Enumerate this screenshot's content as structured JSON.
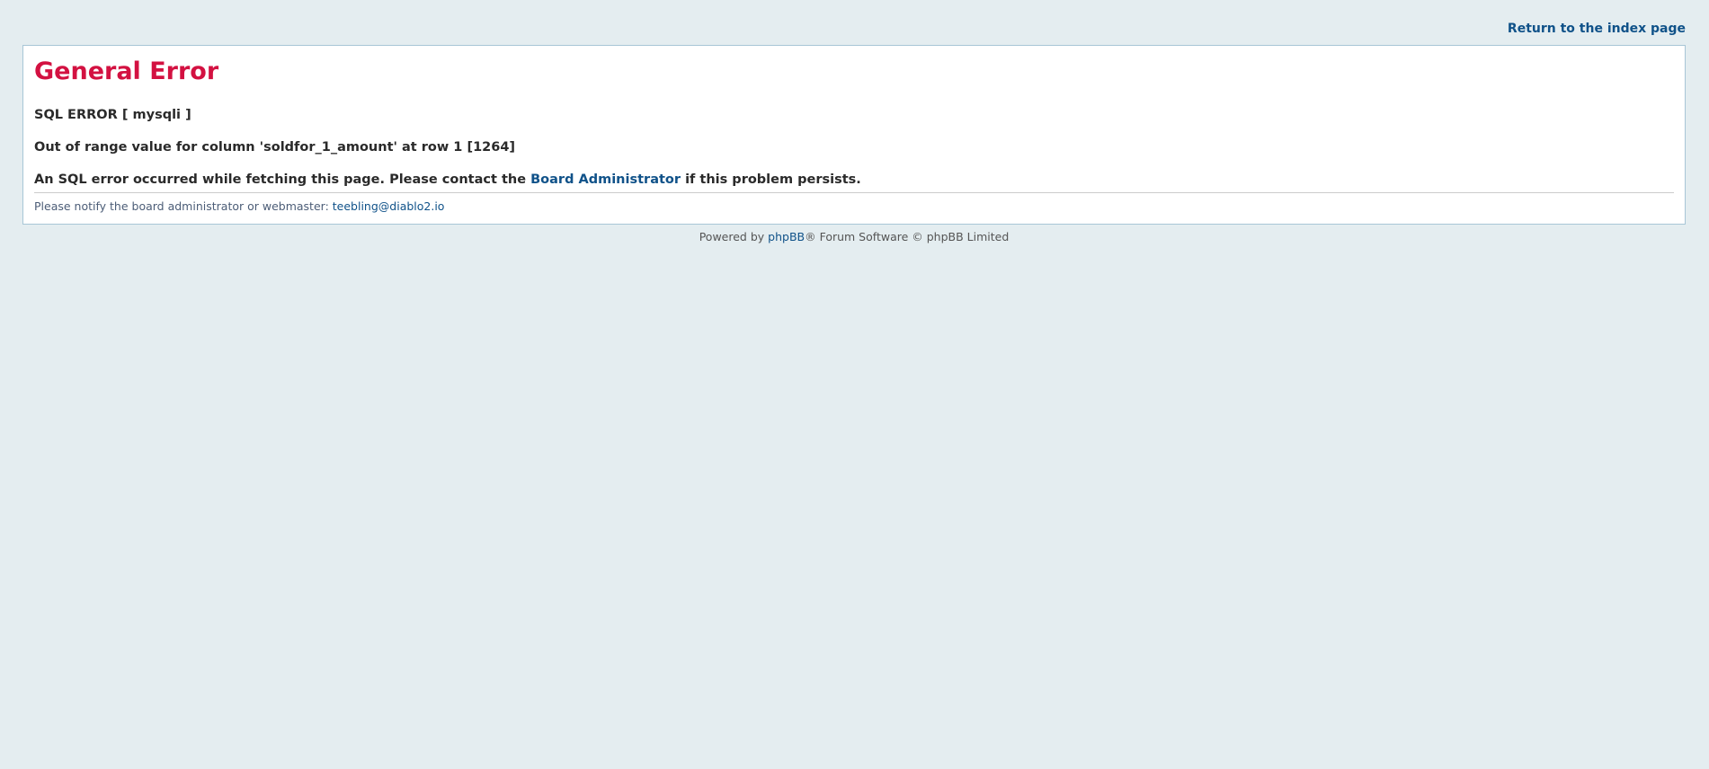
{
  "header": {
    "return_link": "Return to the index page"
  },
  "error": {
    "title": "General Error",
    "line1": "SQL ERROR [ mysqli ]",
    "line2": "Out of range value for column 'soldfor_1_amount' at row 1 [1264]",
    "line3_before": "An SQL error occurred while fetching this page. Please contact the ",
    "line3_link": "Board Administrator",
    "line3_after": " if this problem persists.",
    "notify_text": "Please notify the board administrator or webmaster: ",
    "notify_email": "teebling@diablo2.io"
  },
  "footer": {
    "powered_by": "Powered by ",
    "phpbb_link": "phpBB",
    "suffix": "® Forum Software © phpBB Limited"
  },
  "colors": {
    "background": "#e4edf0",
    "title": "#d31141",
    "link": "#105289",
    "border": "#a8c6d6"
  }
}
